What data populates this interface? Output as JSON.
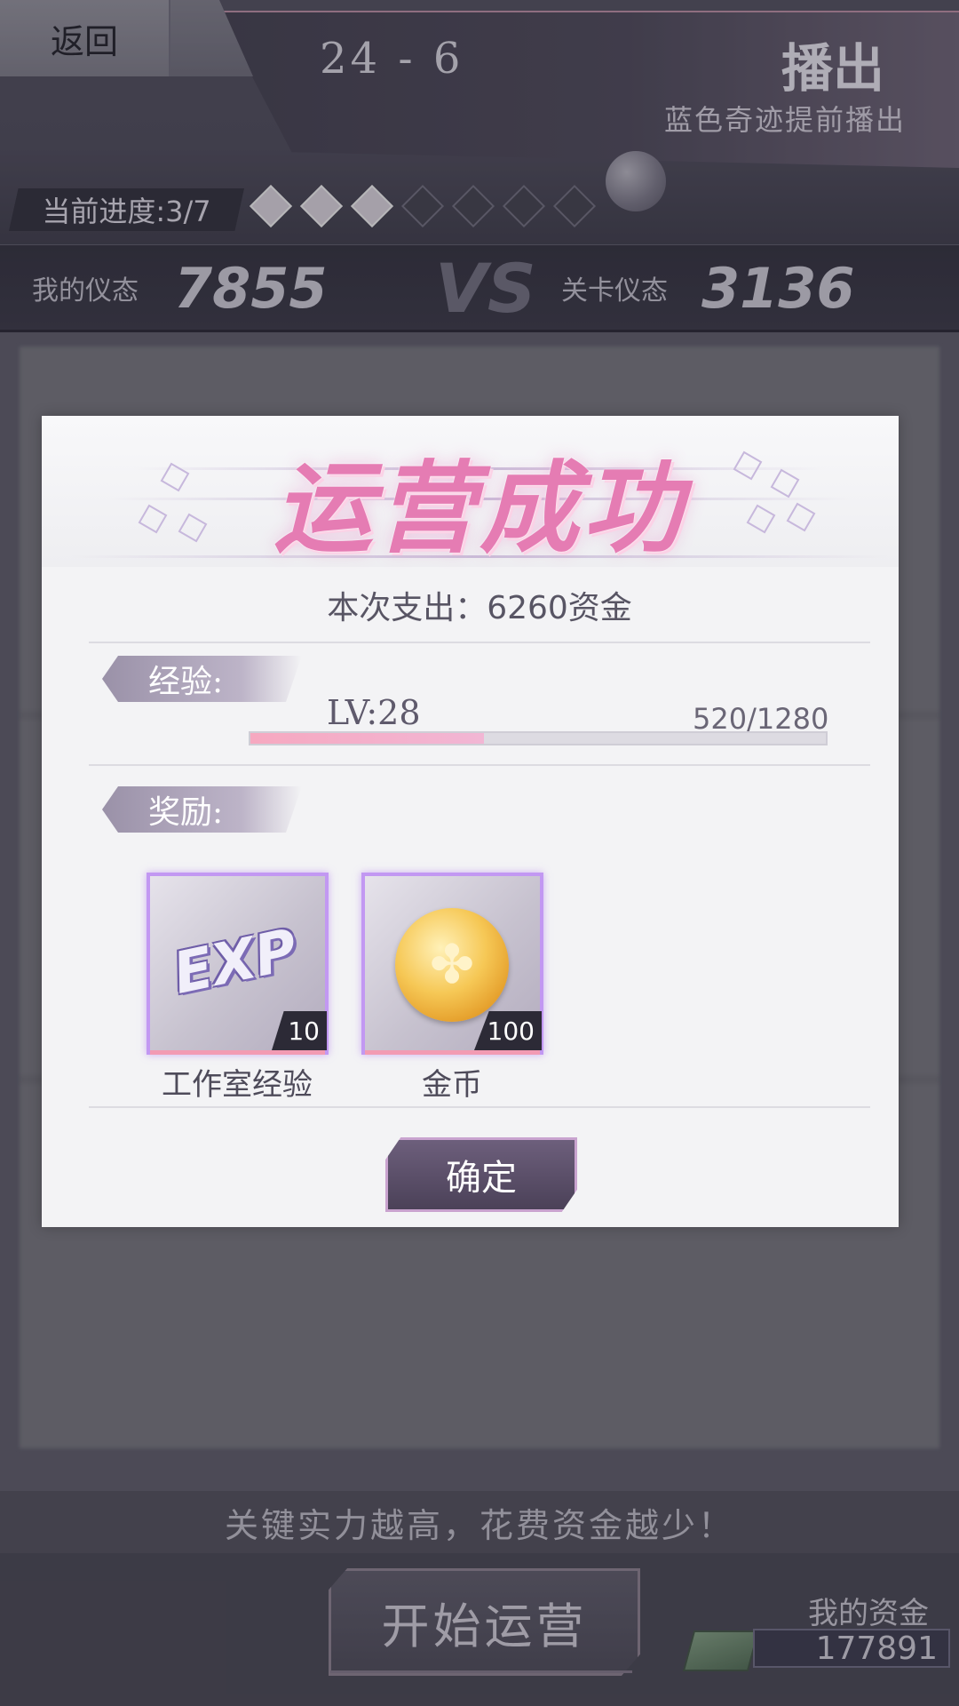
{
  "header": {
    "back_label": "返回",
    "stage_number": "24 - 6",
    "stage_type": "播出",
    "stage_desc": "蓝色奇迹提前播出",
    "progress_label": "当前进度:3/7",
    "progress_filled": 3,
    "progress_total": 7
  },
  "vs": {
    "my_label": "我的仪态",
    "my_value": "7855",
    "vs_text": "VS",
    "level_label": "关卡仪态",
    "level_value": "3136"
  },
  "dialog": {
    "title": "运营成功",
    "expense": "本次支出：6260资金",
    "exp_section_label": "经验:",
    "level": "LV:28",
    "exp_progress": "520/1280",
    "exp_fraction": 0.406,
    "reward_section_label": "奖励:",
    "rewards": [
      {
        "icon": "exp-icon",
        "icon_text": "EXP",
        "count": "10",
        "name": "工作室经验"
      },
      {
        "icon": "coin-icon",
        "icon_text": "✤",
        "count": "100",
        "name": "金币"
      }
    ],
    "confirm_label": "确定"
  },
  "footer": {
    "hint": "关键实力越高，花费资金越少！",
    "start_label": "开始运营",
    "funds_label": "我的资金",
    "funds_value": "177891"
  },
  "colors": {
    "title_pink": "#e57cb3",
    "card_border": "#c298f2",
    "exp_fill": "#f6a8c0"
  }
}
